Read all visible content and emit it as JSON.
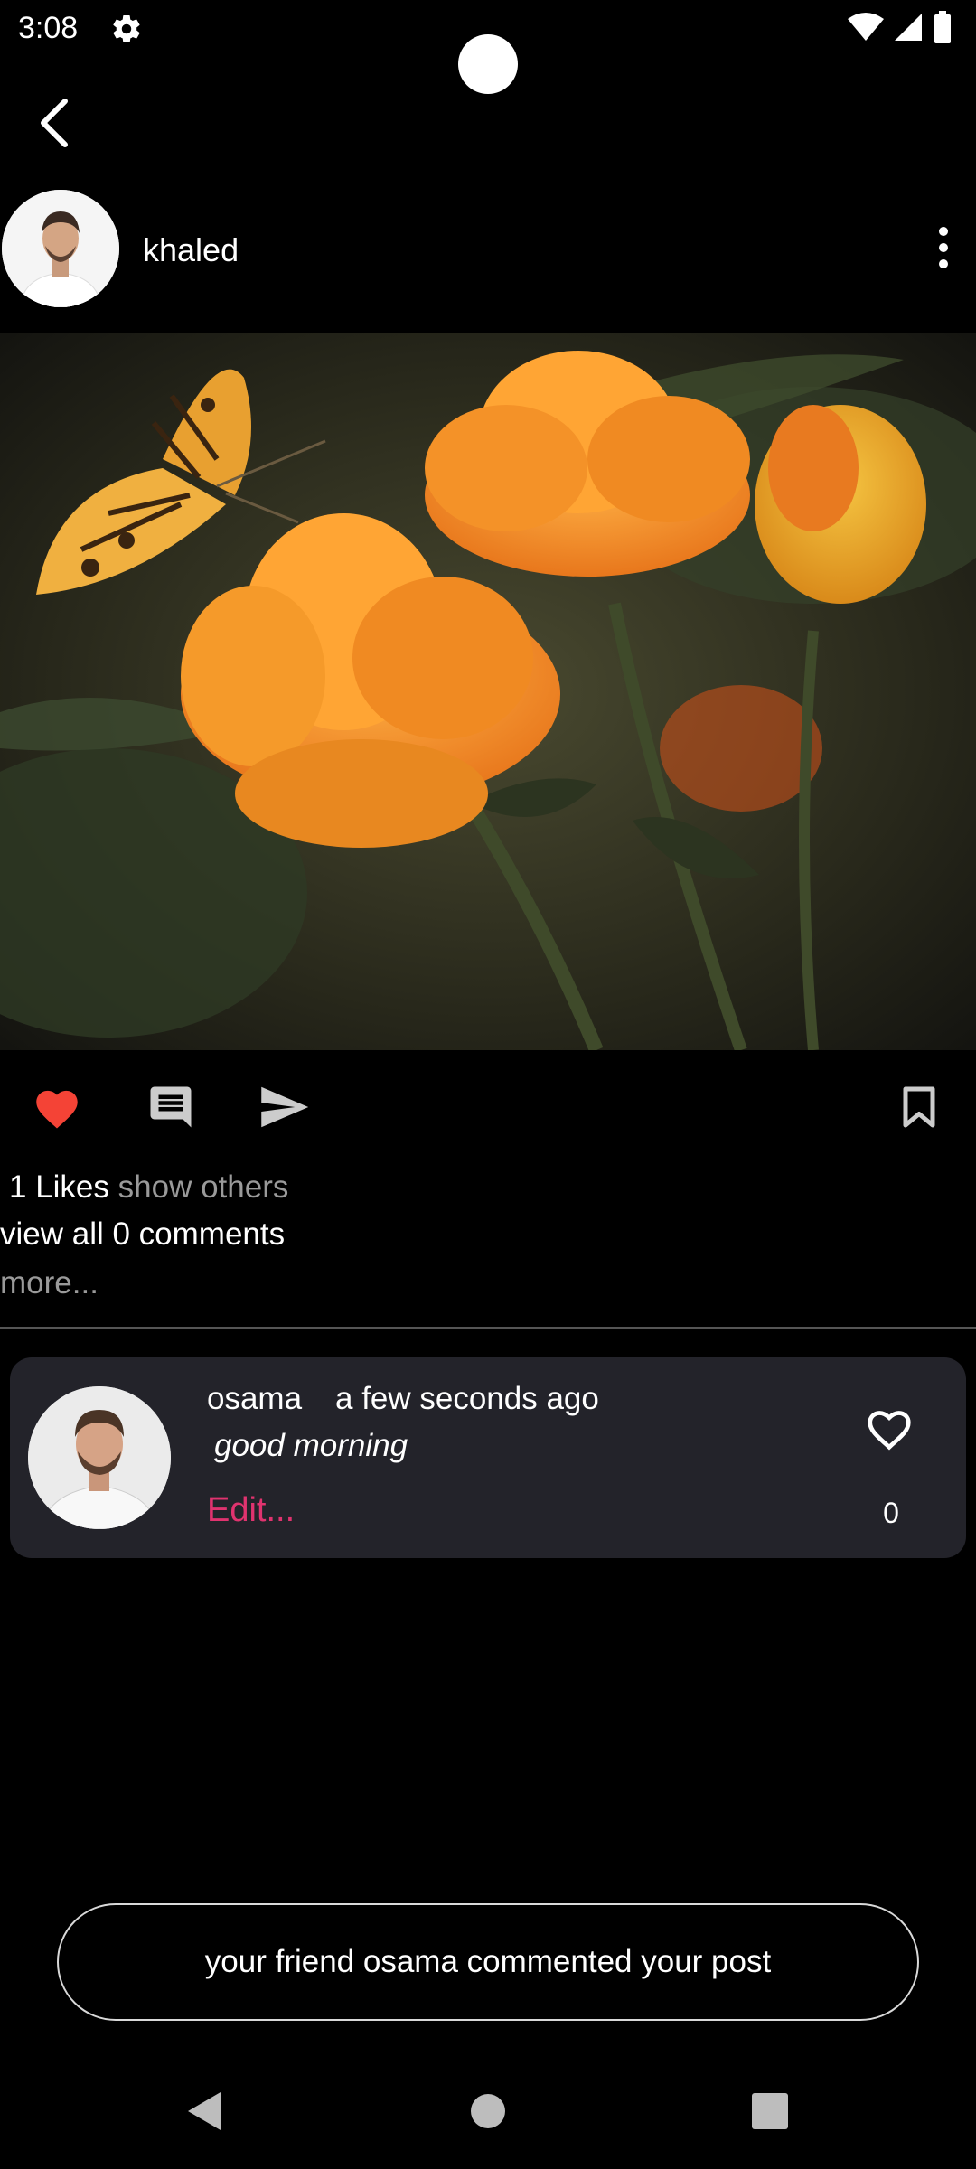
{
  "status_bar": {
    "time": "3:08",
    "icons": [
      "settings-icon",
      "wifi-icon",
      "signal-icon",
      "battery-icon"
    ]
  },
  "post": {
    "author_name": "khaled",
    "likes_count": "1 Likes",
    "likes_others": "show others",
    "comments_link": "view all 0 comments",
    "more_link": "more..."
  },
  "comment": {
    "author": "osama",
    "time": "a few seconds ago",
    "text": "good morning",
    "edit_label": "Edit...",
    "like_count": "0"
  },
  "toast": {
    "message": "your friend osama commented your post"
  },
  "colors": {
    "background": "#000000",
    "card": "#23232a",
    "like_active": "#f44336",
    "edit_accent": "#e0336f",
    "muted_text": "#9a9a9a"
  }
}
